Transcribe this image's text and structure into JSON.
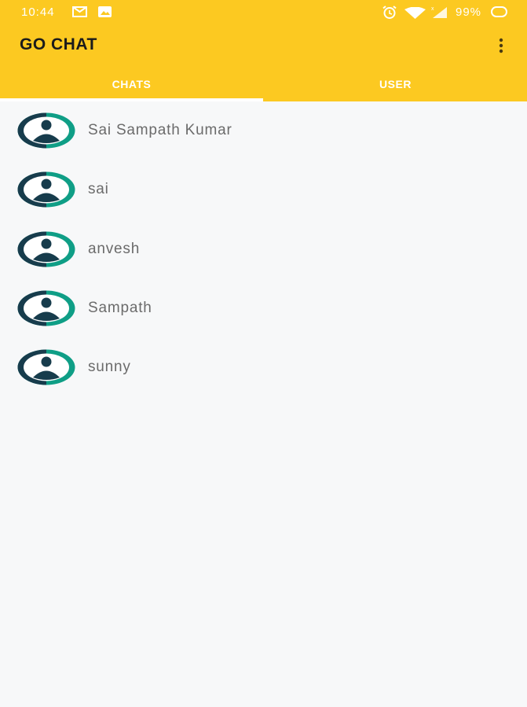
{
  "status_bar": {
    "time": "10:44",
    "battery": "99%",
    "icons": [
      "mail-icon",
      "image-icon",
      "alarm-icon",
      "wifi-icon",
      "signal-icon",
      "battery-icon"
    ]
  },
  "app": {
    "title": "GO CHAT",
    "accent_color": "#fcc921"
  },
  "tabs": [
    {
      "label": "CHATS",
      "selected": true
    },
    {
      "label": "USER",
      "selected": false
    }
  ],
  "users": [
    {
      "name": "Sai Sampath Kumar"
    },
    {
      "name": "sai"
    },
    {
      "name": "anvesh"
    },
    {
      "name": "Sampath"
    },
    {
      "name": "sunny"
    }
  ]
}
